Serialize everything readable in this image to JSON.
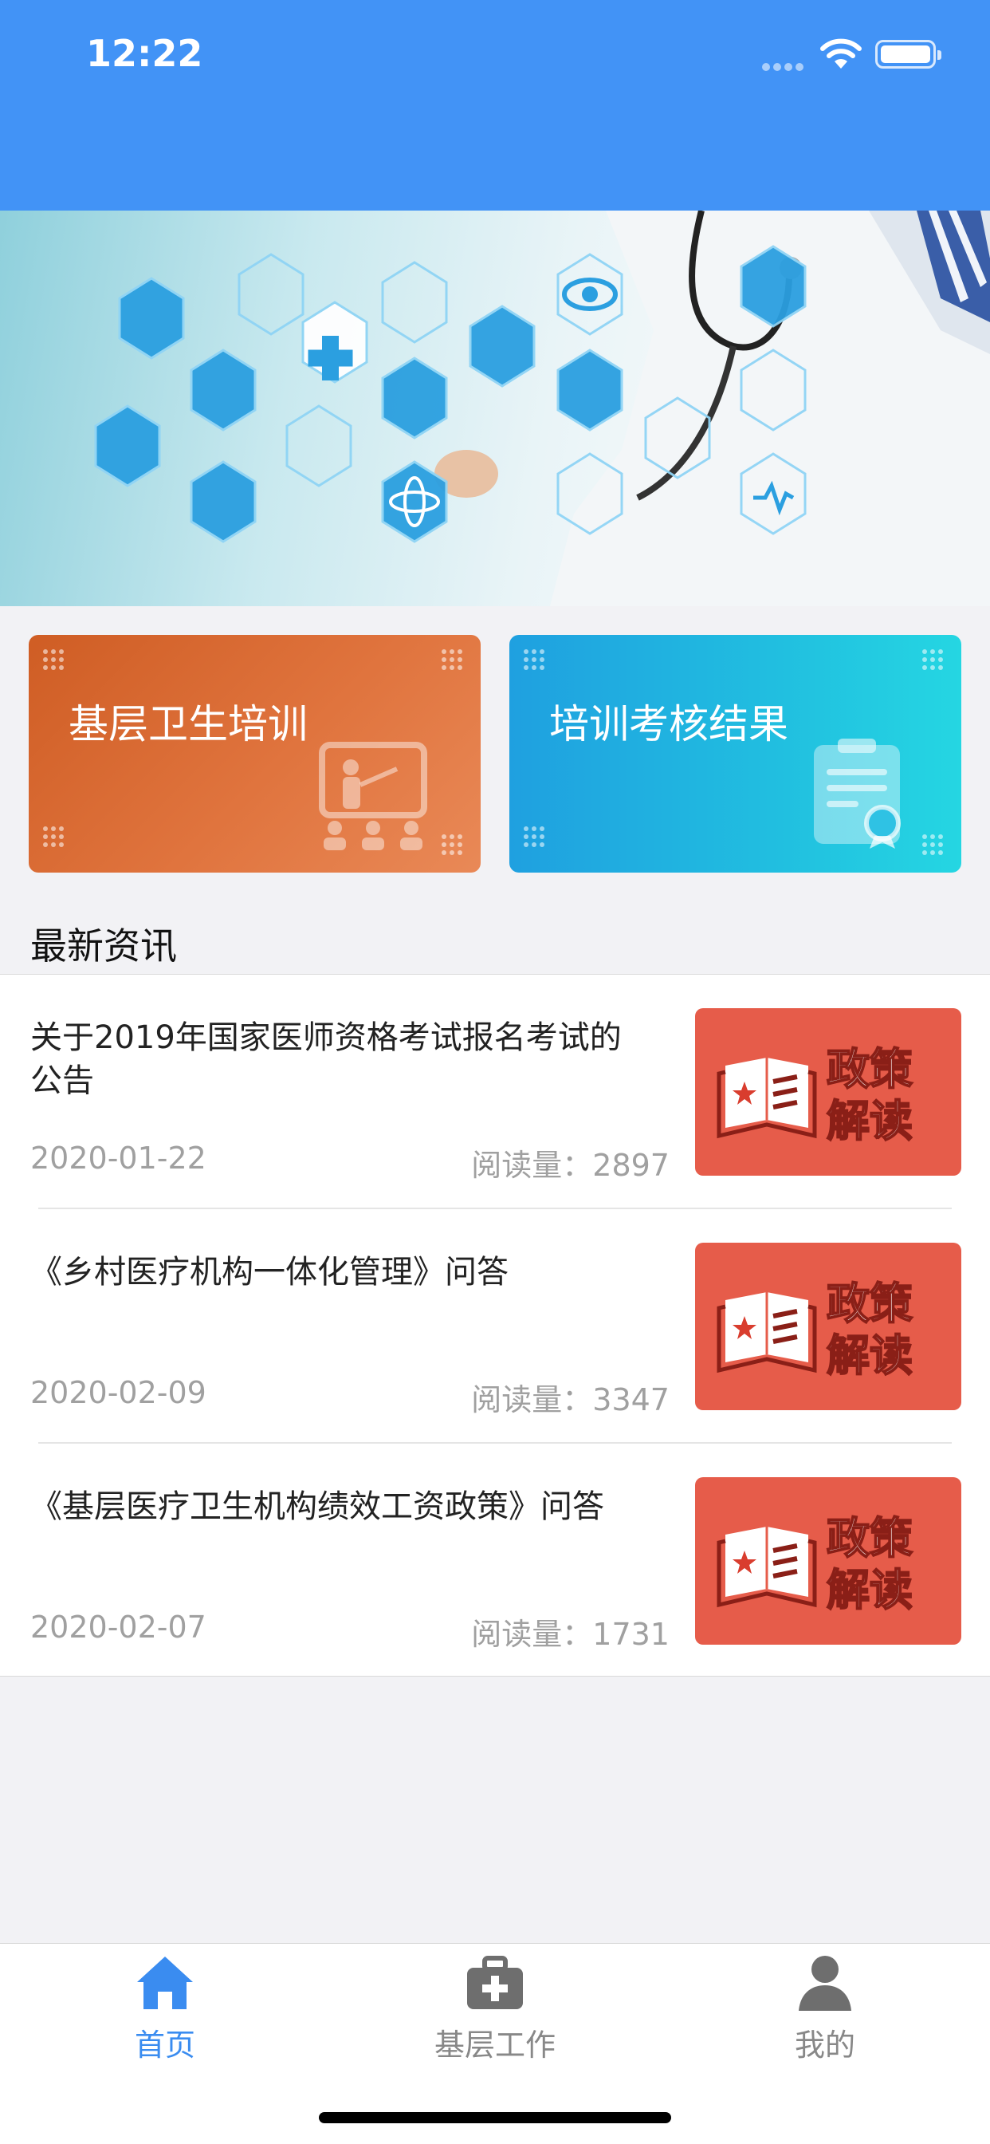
{
  "status_bar": {
    "time": "12:22"
  },
  "banner": {
    "icon": "medical-hexagon-banner"
  },
  "cards": [
    {
      "label": "基层卫生培训",
      "icon": "classroom-teacher-icon",
      "color": "#d8642b"
    },
    {
      "label": "培训考核结果",
      "icon": "certificate-clipboard-icon",
      "color": "#1fb0e0"
    }
  ],
  "section": {
    "title": "最新资讯"
  },
  "news": [
    {
      "title": "关于2019年国家医师资格考试报名考试的公告",
      "date": "2020-01-22",
      "reads_label": "阅读量：",
      "reads": "2897",
      "thumb_text": [
        "政策",
        "解读"
      ]
    },
    {
      "title": "《乡村医疗机构一体化管理》问答",
      "date": "2020-02-09",
      "reads_label": "阅读量：",
      "reads": "3347",
      "thumb_text": [
        "政策",
        "解读"
      ]
    },
    {
      "title": "《基层医疗卫生机构绩效工资政策》问答",
      "date": "2020-02-07",
      "reads_label": "阅读量：",
      "reads": "1731",
      "thumb_text": [
        "政策",
        "解读"
      ]
    }
  ],
  "tabbar": {
    "items": [
      {
        "label": "首页",
        "icon": "home-icon",
        "active": true
      },
      {
        "label": "基层工作",
        "icon": "medical-kit-icon",
        "active": false
      },
      {
        "label": "我的",
        "icon": "person-icon",
        "active": false
      }
    ],
    "active_color": "#3a8cf0",
    "inactive_color": "#888888"
  }
}
